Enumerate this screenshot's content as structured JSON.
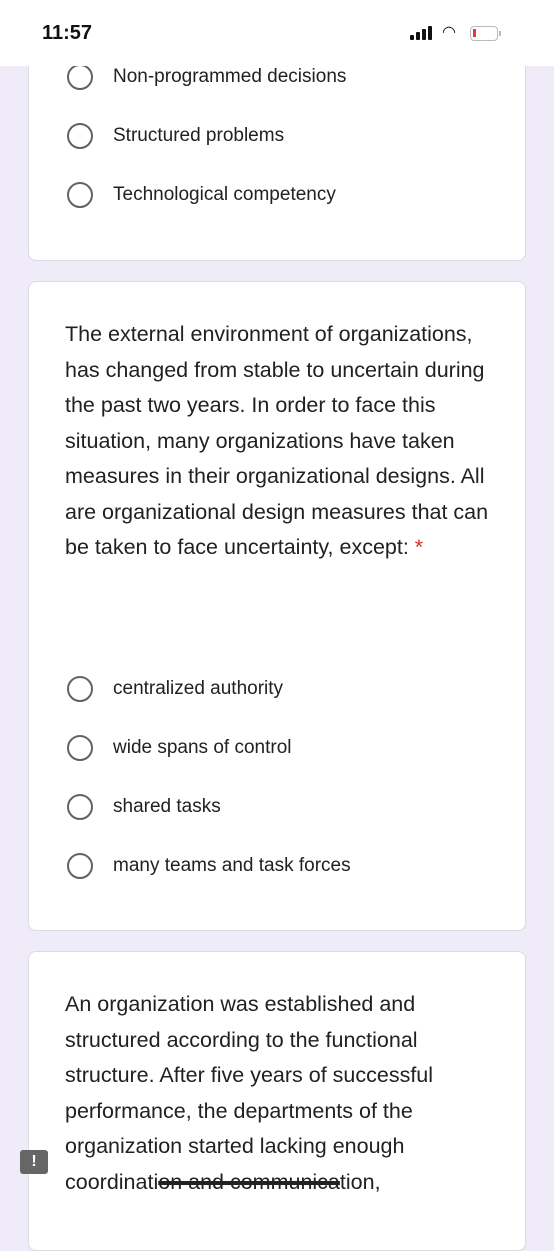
{
  "status": {
    "time": "11:57"
  },
  "q1": {
    "options": [
      "Non-programmed decisions",
      "Structured problems",
      "Technological competency"
    ]
  },
  "q2": {
    "text": "The external environment of organizations, has changed from stable to uncertain during the past two years. In order to face this situation, many organizations have taken measures in their organizational designs. All are organizational design measures that can be taken to face uncertainty, except:",
    "required": "*",
    "options": [
      "centralized authority",
      "wide spans of control",
      "shared tasks",
      "many teams and task forces"
    ]
  },
  "q3": {
    "text": "An organization was established and structured according to the functional structure. After five years of successful performance, the departments of the organization started lacking enough coordinati",
    "struck": "on and communica",
    "tail": "tion,"
  },
  "feedback": {
    "icon": "!"
  }
}
